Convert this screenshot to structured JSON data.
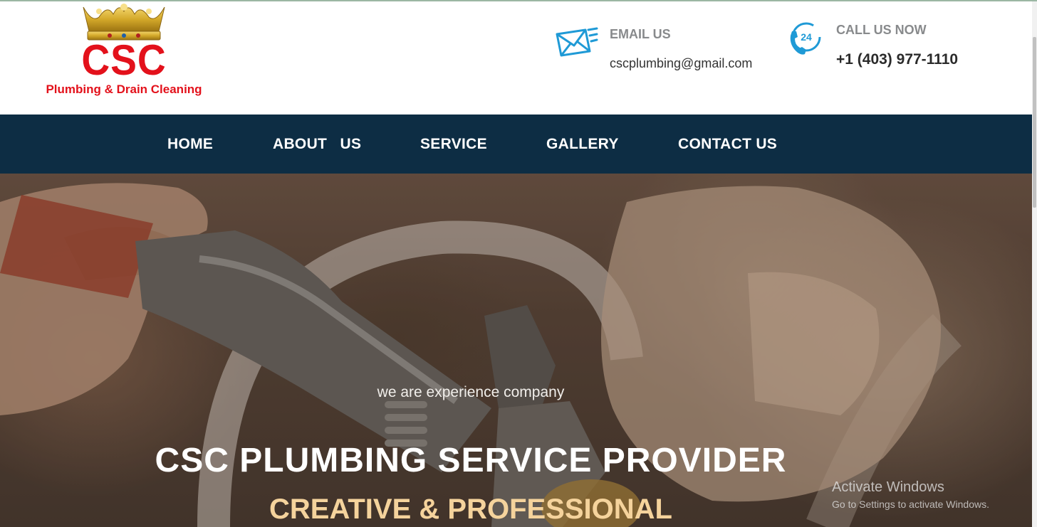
{
  "logo": {
    "brand": "CSC",
    "tagline": "Plumbing & Drain Cleaning",
    "icon": "crown-icon",
    "colors": {
      "brand": "#e3111b",
      "crown": "#d4a92a"
    }
  },
  "contact": {
    "email": {
      "title": "EMAIL US",
      "value": "cscplumbing@gmail.com",
      "icon": "envelope-icon"
    },
    "phone": {
      "title": "CALL US NOW",
      "value": "+1 (403) 977-1110",
      "icon": "phone-24-icon",
      "badge": "24"
    },
    "accent": "#1f9ad6"
  },
  "nav": {
    "items": [
      {
        "label": "HOME"
      },
      {
        "label": "ABOUT   US"
      },
      {
        "label": "SERVICE"
      },
      {
        "label": "GALLERY"
      },
      {
        "label": "CONTACT US"
      }
    ],
    "background": "#0d2d44"
  },
  "hero": {
    "subtitle": "we are experience company",
    "title": "CSC PLUMBING SERVICE PROVIDER",
    "tagline": "CREATIVE & PROFESSIONAL",
    "tagline_color": "#f5d39c"
  },
  "watermark": {
    "line1": "Activate Windows",
    "line2": "Go to Settings to activate Windows."
  }
}
